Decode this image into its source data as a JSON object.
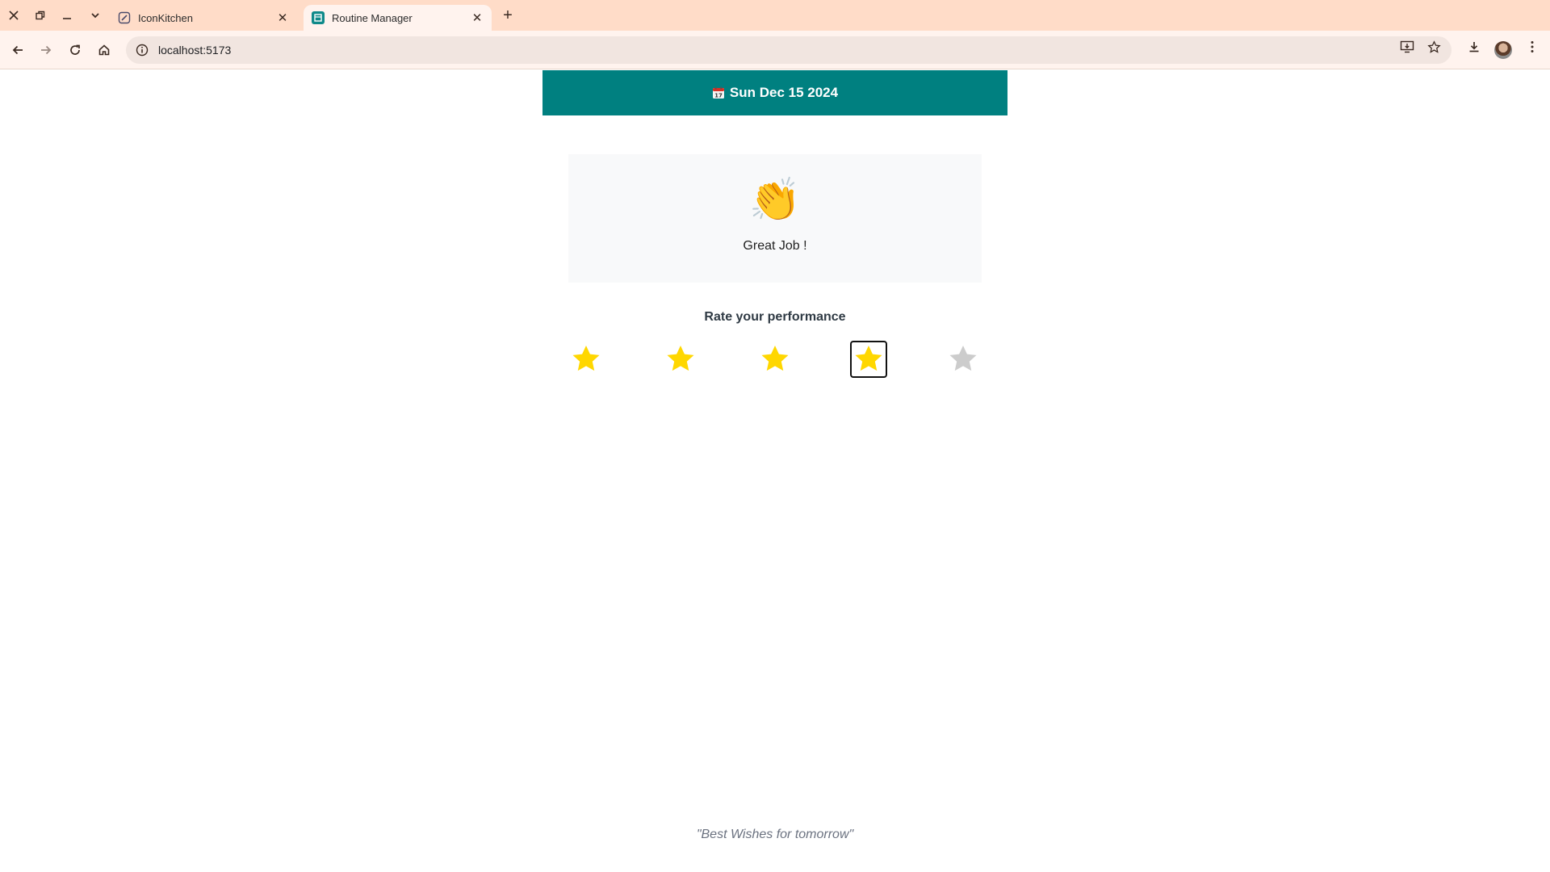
{
  "browser": {
    "tabs": [
      {
        "title": "IconKitchen",
        "active": false
      },
      {
        "title": "Routine Manager",
        "active": true
      }
    ],
    "url": "localhost:5173"
  },
  "header": {
    "date_text": "Sun Dec 15 2024"
  },
  "feedback": {
    "emoji": "👏",
    "message": "Great Job !"
  },
  "rating": {
    "title": "Rate your performance",
    "max": 5,
    "value": 4,
    "filled_color": "#FFD700",
    "empty_color": "#CCCCCC"
  },
  "footer": {
    "quote": "\"Best Wishes for tomorrow\""
  },
  "colors": {
    "header_bg": "#008080",
    "tab_strip": "#FFDCC8",
    "card_bg": "#F8F9FA"
  }
}
